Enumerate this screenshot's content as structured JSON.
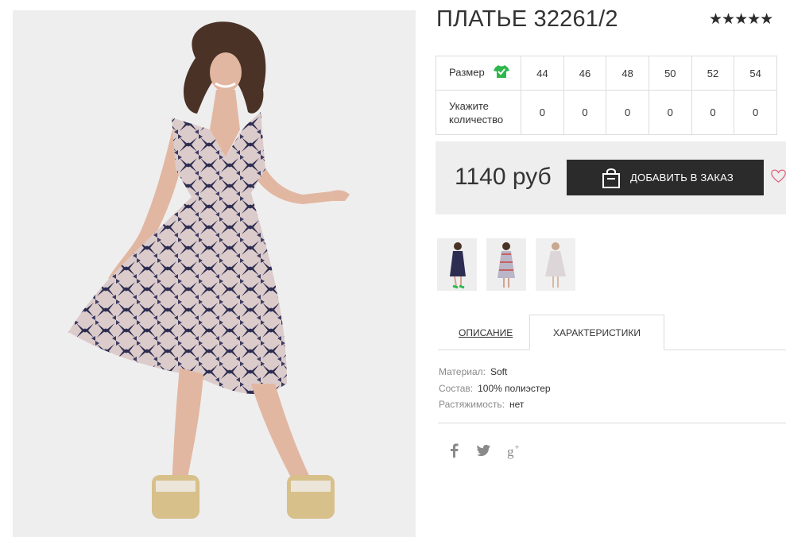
{
  "product": {
    "title": "ПЛАТЬЕ 32261/2",
    "rating_stars": "★★★★★"
  },
  "sizes": {
    "size_label": "Размер",
    "quantity_label": "Укажите количество",
    "values": [
      "44",
      "46",
      "48",
      "50",
      "52",
      "54"
    ],
    "quantities": [
      "0",
      "0",
      "0",
      "0",
      "0",
      "0"
    ]
  },
  "purchase": {
    "price": "1140 руб",
    "add_button_label": "ДОБАВИТЬ В ЗАКАЗ"
  },
  "tabs": {
    "description": "ОПИСАНИЕ",
    "characteristics": "ХАРАКТЕРИСТИКИ"
  },
  "specs": [
    {
      "key": "Материал:",
      "value": "Soft"
    },
    {
      "key": "Состав:",
      "value": "100% полиэстер"
    },
    {
      "key": "Растяжимость:",
      "value": "нет"
    }
  ],
  "icons": {
    "size_chart": "tshirt-check-icon",
    "cart": "shopping-bag-icon",
    "favorite": "heart-icon",
    "social": [
      "facebook-icon",
      "twitter-icon",
      "google-plus-icon"
    ]
  },
  "colors": {
    "accent_green": "#2db84c",
    "button_dark": "#2b2b2b",
    "heart_pink": "#e0607a",
    "dress_navy": "#2c2d50",
    "dress_base": "#d9c8c8"
  }
}
